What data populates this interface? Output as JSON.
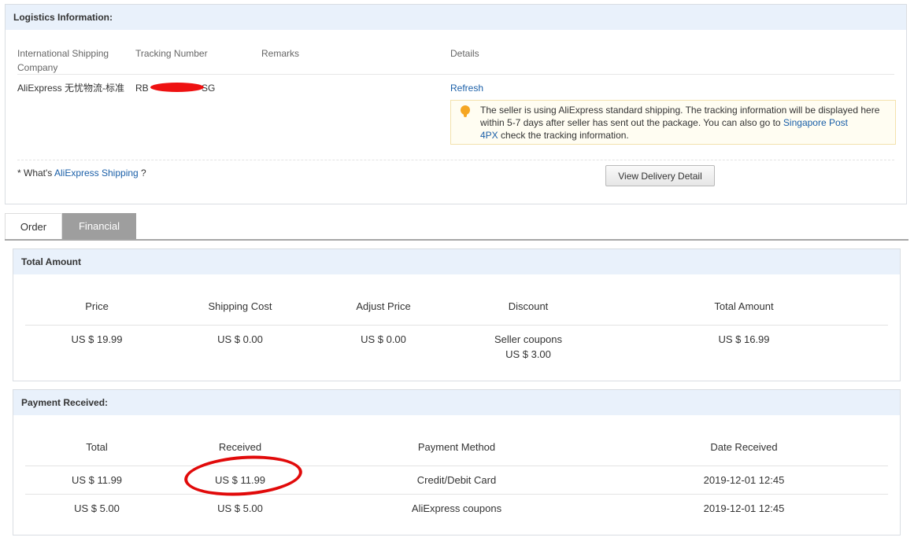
{
  "logistics": {
    "title": "Logistics Information:",
    "headers": {
      "company": "International Shipping Company",
      "tracking": "Tracking Number",
      "remarks": "Remarks",
      "details": "Details"
    },
    "row": {
      "company": "AliExpress 无忧物流-标准",
      "tracking_prefix": "RB",
      "tracking_suffix": "SG",
      "refresh": "Refresh"
    },
    "notice": {
      "text_before": "The seller is using AliExpress standard shipping. The tracking information will be displayed here within 5-7 days after seller has sent out the package. You can also go to ",
      "link1": "Singapore Post",
      "link2": "4PX",
      "text_after": " check the tracking information."
    },
    "whats_prefix": "* What's ",
    "whats_link": "AliExpress Shipping",
    "whats_suffix": " ?",
    "delivery_button": "View Delivery Detail"
  },
  "tabs": {
    "order": "Order",
    "financial": "Financial"
  },
  "total_amount": {
    "title": "Total Amount",
    "headers": [
      "Price",
      "Shipping Cost",
      "Adjust Price",
      "Discount",
      "Total Amount"
    ],
    "values": {
      "price": "US $ 19.99",
      "shipping": "US $ 0.00",
      "adjust": "US $ 0.00",
      "discount_label": "Seller coupons",
      "discount_value": "US $ 3.00",
      "total": "US $ 16.99"
    }
  },
  "payment": {
    "title": "Payment Received:",
    "headers": [
      "Total",
      "Received",
      "Payment Method",
      "Date Received"
    ],
    "rows": [
      {
        "total": "US $ 11.99",
        "received": "US $ 11.99",
        "method": "Credit/Debit Card",
        "date": "2019-12-01 12:45"
      },
      {
        "total": "US $ 5.00",
        "received": "US $ 5.00",
        "method": "AliExpress coupons",
        "date": "2019-12-01 12:45"
      }
    ]
  },
  "colors": {
    "link": "#1a5fa8",
    "header_bg": "#e9f1fb",
    "tab_active_bg": "#9e9e9e",
    "annotation_red": "#e10a0a"
  }
}
